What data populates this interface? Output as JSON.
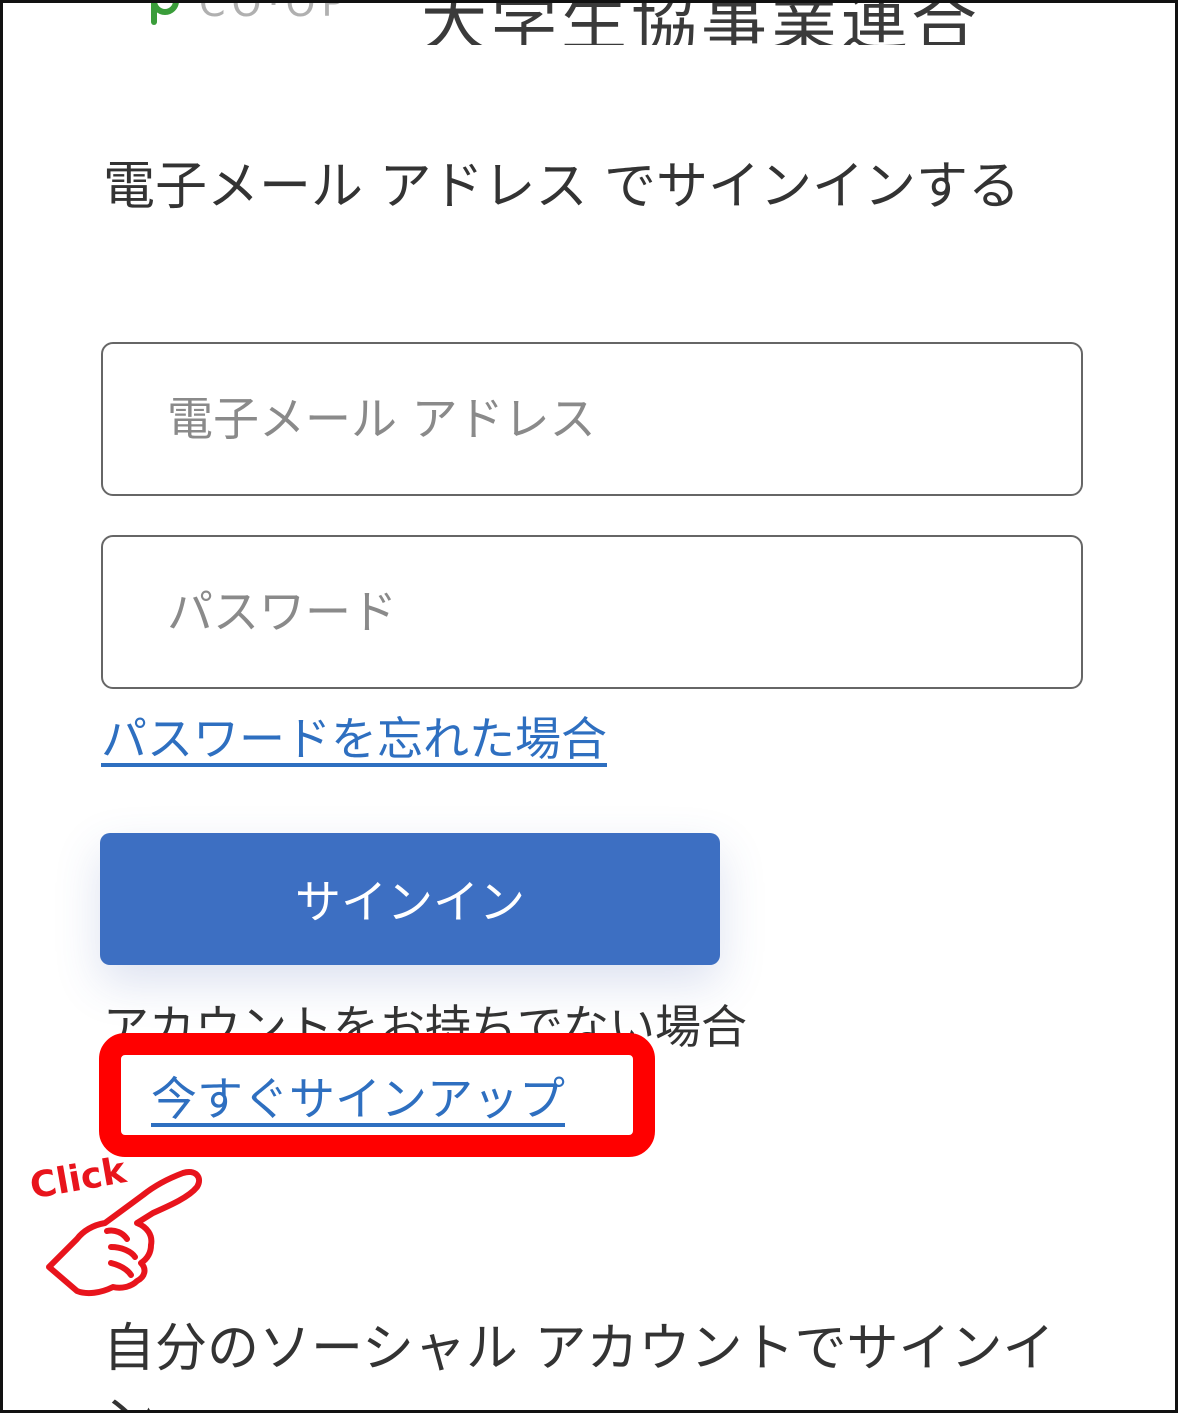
{
  "header": {
    "logo_text": "CO·OP",
    "title": "大学生協事業連合"
  },
  "heading": "電子メール アドレス でサインインする",
  "email_field": {
    "placeholder": "電子メール アドレス",
    "value": ""
  },
  "password_field": {
    "placeholder": "パスワード",
    "value": ""
  },
  "forgot_password_link": "パスワードを忘れた場合",
  "signin_button": "サインイン",
  "no_account_text": "アカウントをお持ちでない場合",
  "signup_link": "今すぐサインアップ",
  "click_callout": "Click",
  "social_heading": "自分のソーシャル アカウントでサインイン",
  "colors": {
    "link": "#2e6fc0",
    "primary_button": "#3d6fc2",
    "highlight": "#ff0000",
    "logo_green": "#3a9d3a"
  }
}
